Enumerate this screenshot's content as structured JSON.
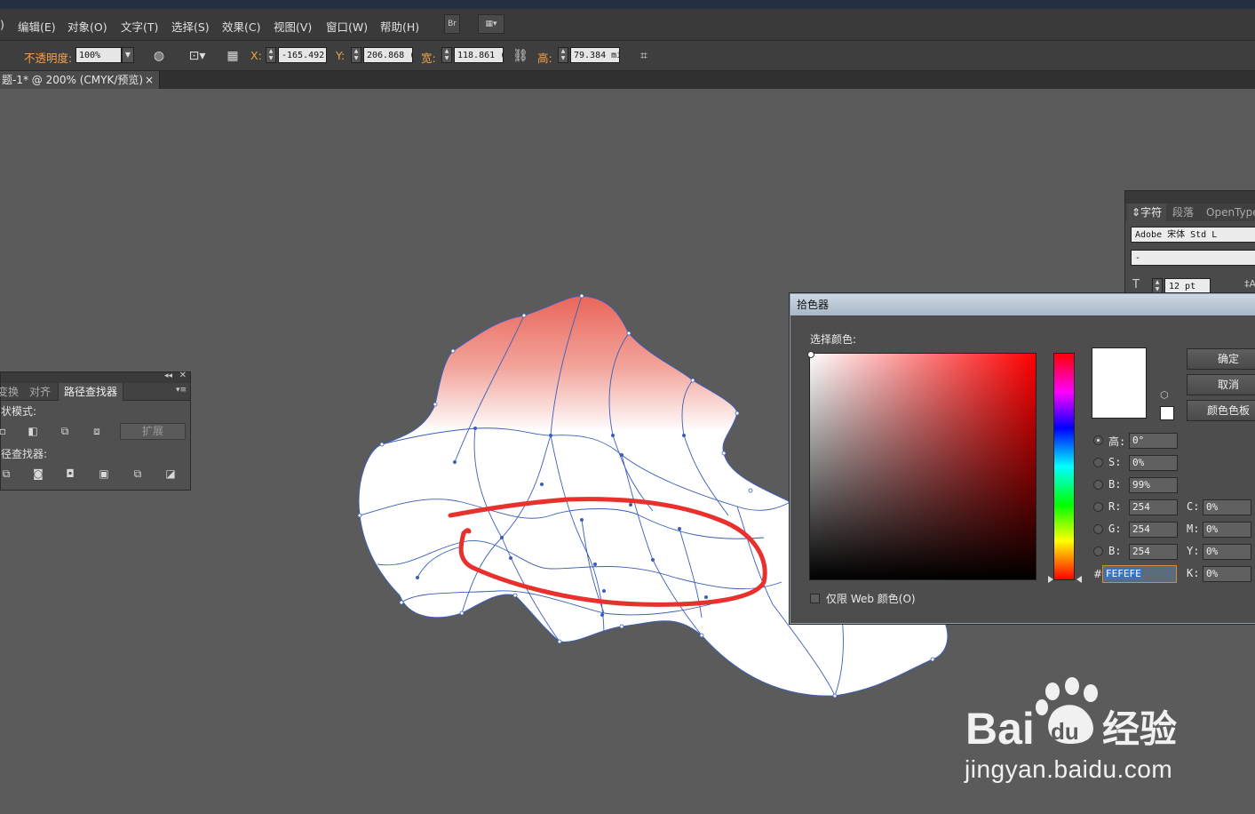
{
  "menu": {
    "items": [
      ")",
      "编辑(E)",
      "对象(O)",
      "文字(T)",
      "选择(S)",
      "效果(C)",
      "视图(V)",
      "窗口(W)",
      "帮助(H)"
    ],
    "br_button": "Br"
  },
  "control": {
    "opacity_label": "不透明度:",
    "opacity_value": "100%",
    "x_label": "X:",
    "x_value": "-165.492",
    "y_label": "Y:",
    "y_value": "206.868 (",
    "w_label": "宽:",
    "w_value": "118.861 (",
    "h_label": "高:",
    "h_value": "79.384 mi"
  },
  "document_tab": {
    "title": "题-1* @ 200% (CMYK/预览)",
    "close": "×"
  },
  "pathfinder": {
    "tabs": [
      "变换",
      "对齐",
      "路径查找器"
    ],
    "shape_modes_label": "状模式:",
    "pathfinders_label": "径查找器:",
    "expand_button": "扩展"
  },
  "character": {
    "tabs": [
      "字符",
      "段落",
      "OpenType"
    ],
    "font_family": "Adobe 宋体 Std L",
    "font_style": "-",
    "font_size": "12 pt"
  },
  "color_picker": {
    "title": "拾色器",
    "select_label": "选择颜色:",
    "ok": "确定",
    "cancel": "取消",
    "swatches": "颜色色板",
    "hsb": [
      {
        "label": "高:",
        "value": "0°"
      },
      {
        "label": "S:",
        "value": "0%"
      },
      {
        "label": "B:",
        "value": "99%"
      }
    ],
    "rgb": [
      {
        "label": "R:",
        "value": "254"
      },
      {
        "label": "G:",
        "value": "254"
      },
      {
        "label": "B:",
        "value": "254"
      }
    ],
    "cmyk": [
      {
        "label": "C:",
        "value": "0%"
      },
      {
        "label": "M:",
        "value": "0%"
      },
      {
        "label": "Y:",
        "value": "0%"
      },
      {
        "label": "K:",
        "value": "0%"
      }
    ],
    "hex": "FEFEFE",
    "web_only": "仅限 Web 颜色(O)",
    "current_color": "#fefefe"
  },
  "watermark": {
    "logo_text": "Bai",
    "logo_text2": "du",
    "logo_cn": "经验",
    "url": "jingyan.baidu.com"
  },
  "colors": {
    "accent_orange": "#f2a14a",
    "gradient_red": "#e85a4f",
    "annotation_red": "#e8302c",
    "mesh_blue": "#3a5fb8"
  }
}
